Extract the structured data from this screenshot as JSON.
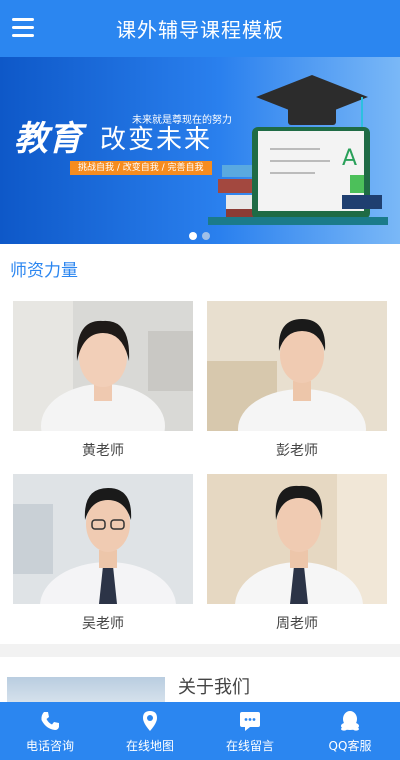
{
  "header": {
    "title": "课外辅导课程模板",
    "menu_icon": "hamburger-menu-icon"
  },
  "banner": {
    "headline_big": "教育",
    "headline_main": "改变未来",
    "slogan": "未来就是尊现在的努力",
    "tags": "挑战自我 / 改变自我 / 完善自我",
    "slide_count": 2,
    "active_slide": 1
  },
  "teachers": {
    "title": "师资力量",
    "items": [
      {
        "name": "黄老师"
      },
      {
        "name": "彭老师"
      },
      {
        "name": "吴老师"
      },
      {
        "name": "周老师"
      }
    ]
  },
  "about": {
    "title": "关于我们"
  },
  "footer": {
    "items": [
      {
        "label": "电话咨询",
        "icon": "phone-icon"
      },
      {
        "label": "在线地图",
        "icon": "map-pin-icon"
      },
      {
        "label": "在线留言",
        "icon": "message-icon"
      },
      {
        "label": "QQ客服",
        "icon": "qq-icon"
      }
    ]
  },
  "colors": {
    "primary": "#2b86f0",
    "accent": "#f68c1f"
  }
}
